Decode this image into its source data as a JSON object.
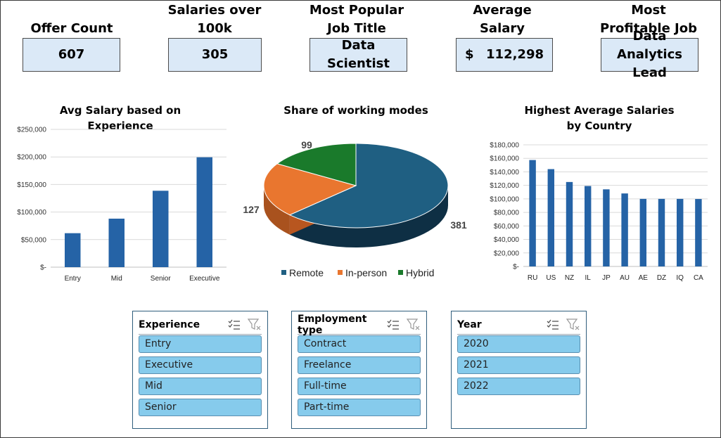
{
  "kpis": {
    "offer_count": {
      "title": "Offer Count",
      "value": "607"
    },
    "salaries_over": {
      "title": "Salaries over 100k",
      "value": "305"
    },
    "popular_job": {
      "title": "Most Popular Job Title",
      "value": "Data Scientist"
    },
    "avg_salary": {
      "title": "Average Salary",
      "currency": "$",
      "value": "112,298"
    },
    "profitable_job": {
      "title": "Most Profitable Job",
      "value": "Data Analytics Lead"
    }
  },
  "chart_data": [
    {
      "type": "bar",
      "title": "Avg Salary based on Experience",
      "categories": [
        "Entry",
        "Mid",
        "Senior",
        "Executive"
      ],
      "values": [
        61643,
        87996,
        138617,
        199392
      ],
      "ylim": [
        0,
        250000
      ],
      "yticks": [
        0,
        50000,
        100000,
        150000,
        200000,
        250000
      ],
      "ytick_labels": [
        "$-",
        "$50,000",
        "$100,000",
        "$150,000",
        "$200,000",
        "$250,000"
      ],
      "gridlines": true,
      "color": "#2563a6"
    },
    {
      "type": "pie",
      "title": "Share of working modes",
      "labels": [
        "Remote",
        "In-person",
        "Hybrid"
      ],
      "values": [
        381,
        127,
        99
      ],
      "value_labels": [
        "381",
        "127",
        "99"
      ],
      "colors": [
        "#1f5f82",
        "#e9762f",
        "#1a7a2b"
      ],
      "legend": "bottom"
    },
    {
      "type": "bar",
      "title": "Highest Average Salaries by Country",
      "categories": [
        "RU",
        "US",
        "NZ",
        "IL",
        "JP",
        "AU",
        "AE",
        "DZ",
        "IQ",
        "CA"
      ],
      "values": [
        157500,
        144055,
        125000,
        119059,
        114127,
        108043,
        100000,
        100000,
        100000,
        99824
      ],
      "ylim": [
        0,
        180000
      ],
      "yticks": [
        0,
        20000,
        40000,
        60000,
        80000,
        100000,
        120000,
        140000,
        160000,
        180000
      ],
      "ytick_labels": [
        "$-",
        "$20,000",
        "$40,000",
        "$60,000",
        "$80,000",
        "$100,000",
        "$120,000",
        "$140,000",
        "$160,000",
        "$180,000"
      ],
      "gridlines": true,
      "color": "#2563a6"
    }
  ],
  "slicers": [
    {
      "title": "Experience",
      "items": [
        "Entry",
        "Executive",
        "Mid",
        "Senior"
      ]
    },
    {
      "title": "Employment type",
      "items": [
        "Contract",
        "Freelance",
        "Full-time",
        "Part-time"
      ]
    },
    {
      "title": "Year",
      "items": [
        "2020",
        "2021",
        "2022"
      ]
    }
  ],
  "icons": {
    "multi_select": "multi-select-icon",
    "clear_filter": "clear-filter-icon"
  }
}
